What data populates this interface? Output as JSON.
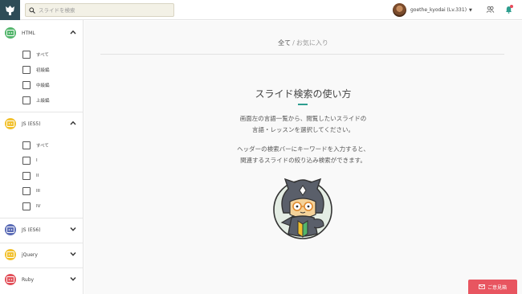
{
  "header": {
    "search_placeholder": "スライドを検索",
    "username": "goethe_kyodai (Lv.331)"
  },
  "sidebar": {
    "sections": [
      {
        "name": "HTML",
        "color": "#52b56b",
        "expanded": true,
        "items": [
          "すべて",
          "初級編",
          "中級編",
          "上級編"
        ]
      },
      {
        "name": "JS (ES5)",
        "color": "#f2c12e",
        "expanded": true,
        "items": [
          "すべて",
          "I",
          "II",
          "III",
          "IV"
        ]
      },
      {
        "name": "JS (ES6)",
        "color": "#5a6bb5",
        "expanded": false
      },
      {
        "name": "jQuery",
        "color": "#f2c12e",
        "expanded": false
      },
      {
        "name": "Ruby",
        "color": "#e2515a",
        "expanded": false
      }
    ]
  },
  "main": {
    "breadcrumb": {
      "all": "全て",
      "separator": "/",
      "favorites": "お気に入り"
    },
    "title": "スライド検索の使い方",
    "para1": [
      "画面左の言語一覧から、閲覧したいスライドの",
      "言語・レッスンを選択してください。"
    ],
    "para2": [
      "ヘッダーの検索バーにキーワードを入力すると、",
      "関連するスライドの絞り込み検索ができます。"
    ]
  },
  "feedback_label": "ご意見箱",
  "colors": {
    "accent": "#2e9e8f",
    "header_logo": "#2e4c57",
    "feedback": "#e85560"
  }
}
